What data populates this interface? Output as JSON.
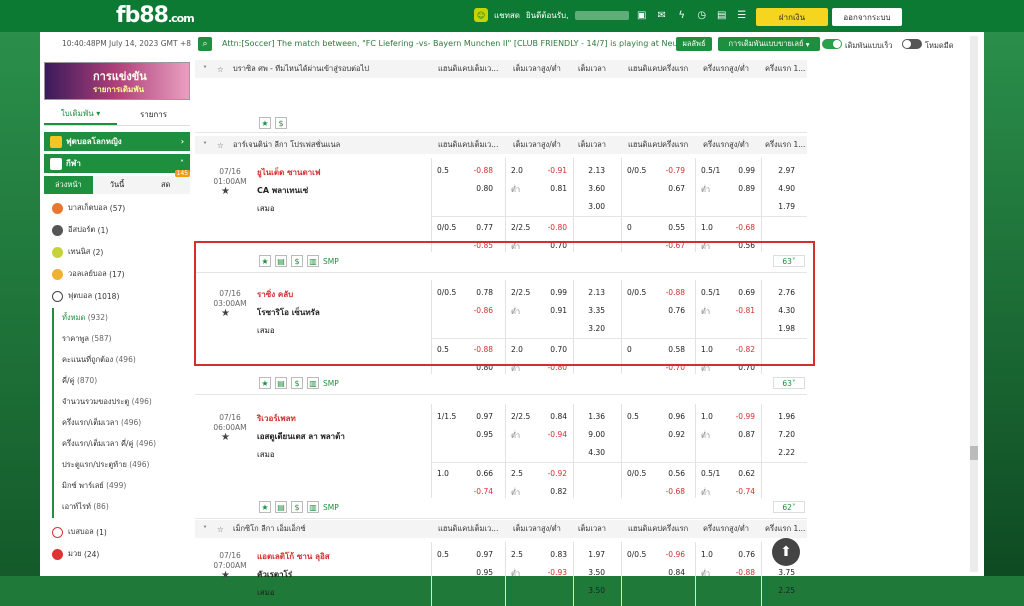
{
  "header": {
    "logo": "fb88",
    "logo_suffix": ".com",
    "chat_label": "แชทสด",
    "welcome": "ยินดีต้อนรับ,",
    "deposit": "ฝากเงิน",
    "logout": "ออกจากระบบ"
  },
  "infobar": {
    "clock": "10:40:48PM July 14, 2023 GMT +8",
    "ticker": "Attn:[Soccer] The match between, \"FC Liefering -vs- Bayern Munchen II\" [CLUB FRIENDLY - 14/7] is playing at Neutral",
    "live": "ผลลัพธ์",
    "select": "การเดิมพันแบบขายเลย์",
    "toggle1": "เดิมพันแบบเร็ว",
    "toggle2": "โหมดมืด"
  },
  "sidebar": {
    "banner_title": "การแข่งขัน",
    "banner_sub": "รายการเดิมพัน",
    "tab_bet": "ใบเดิมพัน",
    "tab_list": "รายการ",
    "cat_worldcup": "ฟุตบอลโลกหญิง",
    "cat_sports": "กีฬา",
    "sub_early": "ล่วงหน้า",
    "sub_today": "วันนี้",
    "sub_live": "สด",
    "live_count": "145",
    "sports": [
      {
        "name": "บาสเก็ตบอล",
        "count": "(57)",
        "color": "#e8762c"
      },
      {
        "name": "อีสปอร์ต",
        "count": "(1)",
        "color": "#555555"
      },
      {
        "name": "เทนนิส",
        "count": "(2)",
        "color": "#c6d23a"
      },
      {
        "name": "วอลเลย์บอล",
        "count": "(17)",
        "color": "#f0b030"
      },
      {
        "name": "ฟุตบอล",
        "count": "(1018)",
        "color": "#ffffff"
      }
    ],
    "soccer_items": [
      {
        "name": "ทั้งหมด",
        "count": "(932)"
      },
      {
        "name": "ราคาพูล",
        "count": "(587)"
      },
      {
        "name": "คะแนนที่ถูกต้อง",
        "count": "(496)"
      },
      {
        "name": "คี่/คู่",
        "count": "(870)"
      },
      {
        "name": "จำนวนรวมของประตู",
        "count": "(496)"
      },
      {
        "name": "ครึ่งแรก/เต็มเวลา",
        "count": "(496)"
      },
      {
        "name": "ครึ่งแรก/เต็มเวลา คี่/คู่",
        "count": "(496)"
      },
      {
        "name": "ประตูแรก/ประตูท้าย",
        "count": "(496)"
      },
      {
        "name": "มิกซ์ พาร์เลย์",
        "count": "(499)"
      },
      {
        "name": "เอาท์ไรท์",
        "count": "(86)"
      }
    ],
    "more_sports": [
      {
        "name": "เบสบอล",
        "count": "(1)",
        "color": "#d33"
      },
      {
        "name": "มวย",
        "count": "(24)",
        "color": "#d33"
      }
    ]
  },
  "columns": {
    "hdp": "แฮนดิแคปเต็มเว...",
    "ou": "เต็มเวลาสูง/ต่ำ",
    "ft": "เต็มเวลา",
    "h1hdp": "แฮนดิแคปครึ่งแรก",
    "h1ou": "ครึ่งแรกสูง/ต่ำ",
    "h1": "ครึ่งแรก 1..."
  },
  "leagues": [
    {
      "name": "บราซิล ศพ - ทีมไหนได้ผ่านเข้าสู่รอบต่อไป"
    },
    {
      "name": "อาร์เจนติน่า ลีกา โปรเฟสชั่นแนล"
    },
    {
      "name": "เม็กซิโก ลีกา เอ็มเอ็กซ์"
    }
  ],
  "matches": [
    {
      "date": "07/16",
      "time": "01:00AM",
      "home": "ยูไนเต็ด ซานตาเฟ",
      "away": "CA พลาเทนเซ่",
      "draw": "เสมอ",
      "r1": {
        "hdp": "0.5",
        "h1": "-0.88",
        "h2": "0.80",
        "ou": "2.0",
        "o1": "-0.91",
        "o2": "0.81",
        "ou_lo": "ต่ำ",
        "ft1": "2.13",
        "ft2": "3.60",
        "ft3": "3.00",
        "fh_hdp": "0/0.5",
        "fh1": "-0.79",
        "fh2": "0.67",
        "fh_ou": "0.5/1",
        "fo1": "0.99",
        "fo2": "0.89",
        "fo_lo": "ต่ำ",
        "x1": "2.97",
        "x2": "4.90",
        "x3": "1.79"
      },
      "r2": {
        "hdp": "0/0.5",
        "h1": "0.77",
        "h2": "-0.85",
        "ou": "2/2.5",
        "o1": "-0.80",
        "o2": "0.70",
        "ou_lo": "ต่ำ",
        "fh_hdp": "0",
        "fh1": "0.55",
        "fh2": "-0.67",
        "fh_ou": "1.0",
        "fo1": "-0.68",
        "fo2": "0.56",
        "fo_lo": "ต่ำ"
      },
      "more": "63"
    },
    {
      "date": "07/16",
      "time": "03:00AM",
      "home": "ราซิ่ง คลับ",
      "away": "โรซาริโอ เซ็นทรัล",
      "draw": "เสมอ",
      "r1": {
        "hdp": "0/0.5",
        "h1": "0.78",
        "h2": "-0.86",
        "ou": "2/2.5",
        "o1": "0.99",
        "o2": "0.91",
        "ou_lo": "ต่ำ",
        "ft1": "2.13",
        "ft2": "3.35",
        "ft3": "3.20",
        "fh_hdp": "0/0.5",
        "fh1": "-0.88",
        "fh2": "0.76",
        "fh_ou": "0.5/1",
        "fo1": "0.69",
        "fo2": "-0.81",
        "fo_lo": "ต่ำ",
        "x1": "2.76",
        "x2": "4.30",
        "x3": "1.98"
      },
      "r2": {
        "hdp": "0.5",
        "h1": "-0.88",
        "h2": "0.80",
        "ou": "2.0",
        "o1": "0.70",
        "o2": "-0.80",
        "ou_lo": "ต่ำ",
        "fh_hdp": "0",
        "fh1": "0.58",
        "fh2": "-0.70",
        "fh_ou": "1.0",
        "fo1": "-0.82",
        "fo2": "0.70",
        "fo_lo": "ต่ำ"
      },
      "more": "63"
    },
    {
      "date": "07/16",
      "time": "06:00AM",
      "home": "ริเวอร์เพลท",
      "away": "เอสตูเดียนเตส ลา พลาต้า",
      "draw": "เสมอ",
      "r1": {
        "hdp": "1/1.5",
        "h1": "0.97",
        "h2": "0.95",
        "ou": "2/2.5",
        "o1": "0.84",
        "o2": "-0.94",
        "ou_lo": "ต่ำ",
        "ft1": "1.36",
        "ft2": "9.00",
        "ft3": "4.30",
        "fh_hdp": "0.5",
        "fh1": "0.96",
        "fh2": "0.92",
        "fh_ou": "1.0",
        "fo1": "-0.99",
        "fo2": "0.87",
        "fo_lo": "ต่ำ",
        "x1": "1.96",
        "x2": "7.20",
        "x3": "2.22"
      },
      "r2": {
        "hdp": "1.0",
        "h1": "0.66",
        "h2": "-0.74",
        "ou": "2.5",
        "o1": "-0.92",
        "o2": "0.82",
        "ou_lo": "ต่ำ",
        "fh_hdp": "0/0.5",
        "fh1": "0.56",
        "fh2": "-0.68",
        "fh_ou": "0.5/1",
        "fo1": "0.62",
        "fo2": "-0.74",
        "fo_lo": "ต่ำ"
      },
      "more": "62"
    },
    {
      "date": "07/16",
      "time": "07:00AM",
      "home": "แอตเลติโก้ ซาน ลุอิส",
      "away": "คัวเรตาโร่",
      "draw": "เสมอ",
      "r1": {
        "hdp": "0.5",
        "h1": "0.97",
        "h2": "0.95",
        "ou": "2.5",
        "o1": "0.83",
        "o2": "-0.93",
        "ou_lo": "ต่ำ",
        "ft1": "1.97",
        "ft2": "3.50",
        "ft3": "3.50",
        "fh_hdp": "0/0.5",
        "fh1": "-0.96",
        "fh2": "0.84",
        "fh_ou": "1.0",
        "fo1": "0.76",
        "fo2": "-0.88",
        "fo_lo": "ต่ำ",
        "x1": "2.66",
        "x2": "3.75",
        "x3": "2.25"
      }
    }
  ],
  "tools": {
    "smp": "SMP",
    "dollar": "$",
    "star": "★"
  },
  "colors": {
    "brand": "#1e8f3e",
    "negative": "#d32f2f",
    "highlight": "#d32f2f",
    "deposit": "#f5d51f"
  }
}
